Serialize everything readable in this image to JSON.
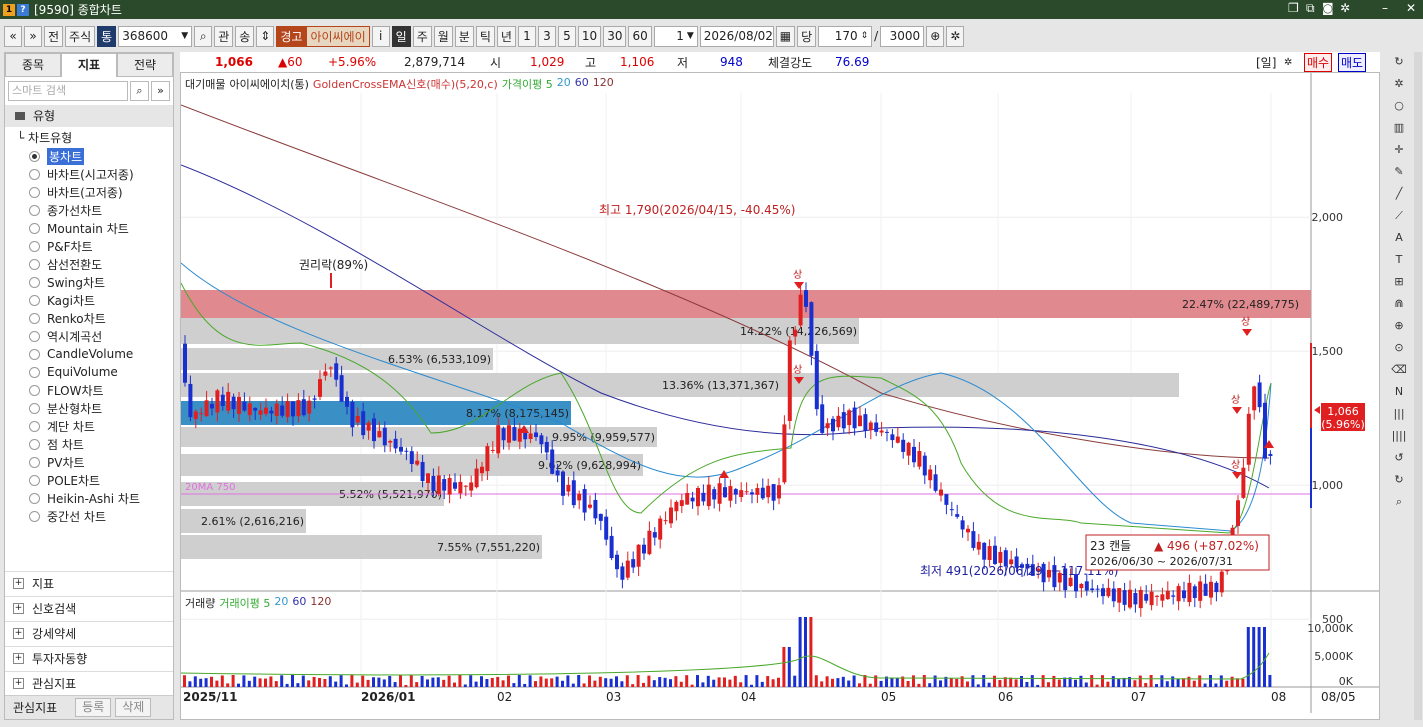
{
  "window": {
    "title": "[9590] 종합차트",
    "q1": "1",
    "q2": "?"
  },
  "toolbar": {
    "b1": "«",
    "b2": "»",
    "b3": "전",
    "b4": "주식",
    "b5": "통",
    "code": "368600",
    "b7": "관",
    "b8": "송",
    "warn": "경고",
    "name": "아이씨에이",
    "info": "i",
    "periods": [
      "일",
      "주",
      "월",
      "분",
      "틱",
      "년"
    ],
    "mins": [
      "1",
      "3",
      "5",
      "10",
      "30",
      "60"
    ],
    "minval": "1",
    "date": "2026/08/02",
    "dang": "당",
    "count": "170",
    "slash": "/",
    "total": "3000"
  },
  "left": {
    "tabs": [
      "종목",
      "지표",
      "전략"
    ],
    "search_placeholder": "스마트 검색",
    "group": "유형",
    "subgroup": "차트유형",
    "items": [
      "봉차트",
      "바차트(시고저종)",
      "바차트(고저종)",
      "종가선차트",
      "Mountain 차트",
      "P&F차트",
      "삼선전환도",
      "Swing차트",
      "Kagi차트",
      "Renko차트",
      "역시계곡선",
      "CandleVolume",
      "EquiVolume",
      "FLOW차트",
      "분산형차트",
      "계단 차트",
      "점 차트",
      "PV차트",
      "POLE차트",
      "Heikin-Ashi 차트",
      "중간선 차트"
    ],
    "bottom": [
      "지표",
      "신호검색",
      "강세약세",
      "투자자동향",
      "관심지표"
    ],
    "fav": "관심지표",
    "reg": "등록",
    "del": "삭제"
  },
  "info": {
    "price": "1,066",
    "change": "▲60",
    "pct": "+5.96%",
    "volume": "2,879,714",
    "open_l": "시",
    "open": "1,029",
    "high_l": "고",
    "high": "1,106",
    "low_l": "저",
    "low": "948",
    "str_l": "체결강도",
    "str": "76.69",
    "day": "[일]",
    "buy": "매수",
    "sell": "매도"
  },
  "legend": {
    "l1": "대기매물",
    "l2": "아이씨에이치(통)",
    "l3": "GoldenCrossEMA신호(매수)(5,20,c)",
    "l4": "가격이평 5",
    "l5": "20",
    "l6": "60",
    "l7": "120"
  },
  "vlegend": {
    "l1": "거래량",
    "l2": "거래이평 5",
    "l3": "20",
    "l4": "60",
    "l5": "120"
  },
  "price_axis": [
    "2,000",
    "1,500",
    "1,000",
    "500"
  ],
  "vol_axis": [
    "10,000K",
    "5,000K",
    "0K"
  ],
  "x_axis": [
    "2025/11",
    "2026/01",
    "02",
    "03",
    "04",
    "05",
    "06",
    "07",
    "08",
    "08/05"
  ],
  "annotations": {
    "high": "최고 1,790(2026/04/15, -40.45%)",
    "low": "최저 491(2026/06/29, +117.11%)",
    "rights": "권리락(89%)",
    "ema": "20MA 750",
    "cur_price": "1,066",
    "cur_pct": "(5.96%)",
    "box_l1": "23 캔들",
    "box_l2": "▲ 496 (+87.02%)",
    "box_l3": "2026/06/30 ~ 2026/07/31",
    "sig": "상"
  },
  "profile": [
    {
      "label": "22.47% (22,489,775)"
    },
    {
      "label": "14.22% (14,226,569)"
    },
    {
      "label": "6.53% (6,533,109)"
    },
    {
      "label": "13.36% (13,371,367)"
    },
    {
      "label": "8.17% (8,175,145)"
    },
    {
      "label": "9.95% (9,959,577)"
    },
    {
      "label": "9.62% (9,628,994)"
    },
    {
      "label": "5.52% (5,521,970)"
    },
    {
      "label": "2.61% (2,616,216)"
    },
    {
      "label": "7.55% (7,551,220)"
    }
  ]
}
